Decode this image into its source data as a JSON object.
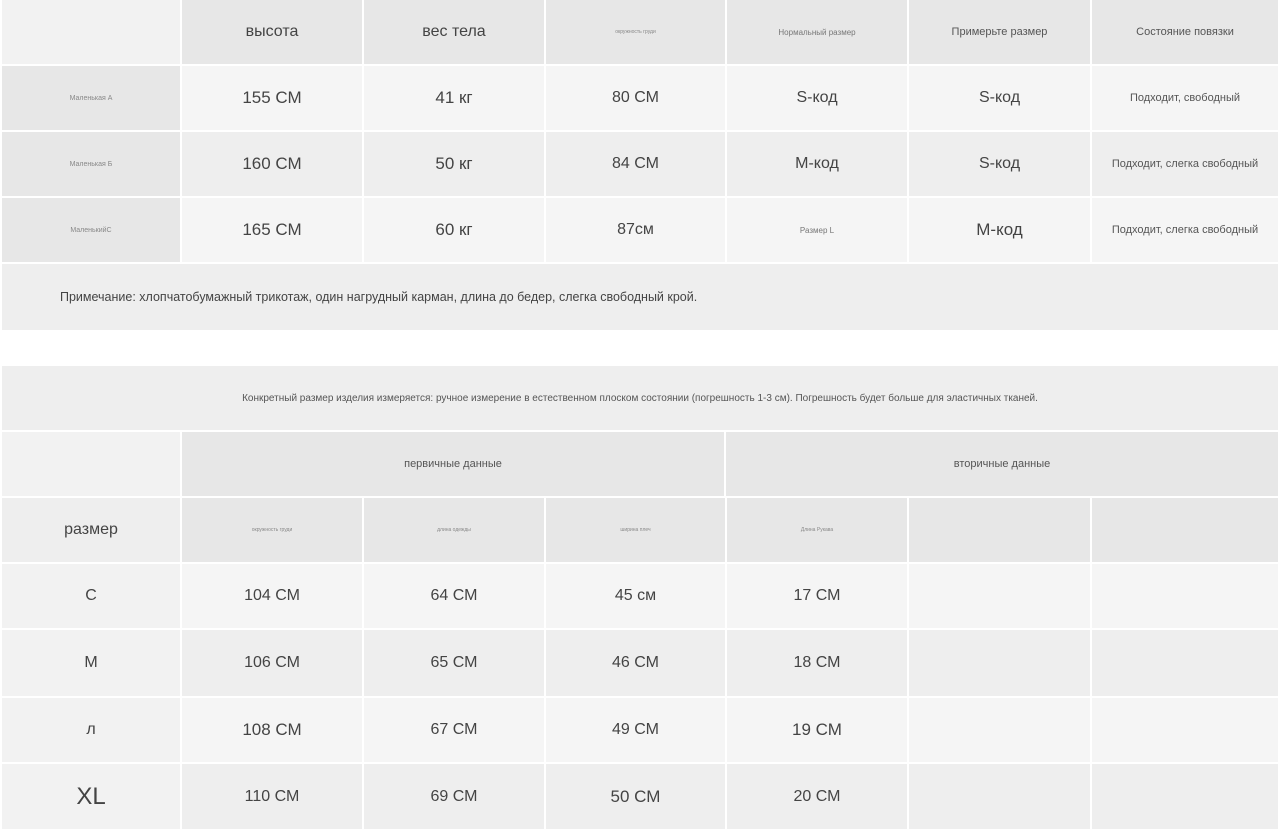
{
  "fit_table": {
    "header": [
      "",
      "высота",
      "вес тела",
      "окружность груди",
      "Нормальный размер",
      "Примерьте размер",
      "Состояние повязки"
    ],
    "rows": [
      {
        "label": "Маленькая А",
        "height": "155 СМ",
        "weight": "41 кг",
        "bust": "80 СМ",
        "normal": "S-код",
        "try": "S-код",
        "state": "Подходит, свободный"
      },
      {
        "label": "Маленькая Б",
        "height": "160 СМ",
        "weight": "50 кг",
        "bust": "84 СМ",
        "normal": "М-код",
        "try": "S-код",
        "state": "Подходит, слегка свободный"
      },
      {
        "label": "МаленькийС",
        "height": "165 СМ",
        "weight": "60 кг",
        "bust": "87см",
        "normal": "Размер L",
        "try": "М-код",
        "state": "Подходит, слегка свободный"
      }
    ],
    "note": "Примечание: хлопчатобумажный трикотаж, один нагрудный карман, длина до бедер, слегка свободный крой."
  },
  "size_table": {
    "spec": "Конкретный размер изделия измеряется: ручное измерение в естественном плоском состоянии (погрешность 1-3 см). Погрешность будет больше для эластичных тканей.",
    "group_primary": "первичные данные",
    "group_secondary": "вторичные данные",
    "columns": [
      "размер",
      "окружность груди",
      "длина одежды",
      "ширина плеч",
      "Длина Рукава",
      "",
      ""
    ],
    "rows": [
      {
        "size": "С",
        "bust": "104 СМ",
        "length": "64 СМ",
        "shoulder": "45 см",
        "sleeve": "17 СМ"
      },
      {
        "size": "М",
        "bust": "106 СМ",
        "length": "65 СМ",
        "shoulder": "46 СМ",
        "sleeve": "18 СМ"
      },
      {
        "size": "л",
        "bust": "108 СМ",
        "length": "67 СМ",
        "shoulder": "49 СМ",
        "sleeve": "19 СМ"
      },
      {
        "size": "XL",
        "bust": "110 СМ",
        "length": "69 СМ",
        "shoulder": "50 СМ",
        "sleeve": "20 СМ"
      }
    ]
  }
}
